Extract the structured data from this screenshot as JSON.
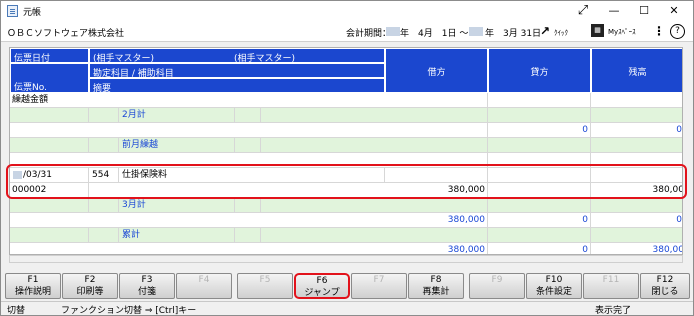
{
  "window": {
    "title": "元帳",
    "minimize": "—",
    "maximize": "☐",
    "close": "✕",
    "expand_icon": "arrows-expand-icon"
  },
  "infobar": {
    "company": "ＯＢＣソフトウェア株式会社",
    "period_label": "会計期間：",
    "period_from": "年　4月　1日 ～",
    "period_to": "年　3月 31日",
    "quick_label": "ｸｲｯｸ",
    "myspace_label": "Myｽﾍﾟｰｽ",
    "more": "⋮",
    "help": "?"
  },
  "grid": {
    "headers": {
      "date": "伝票日付",
      "partner1": "(相手マスター)",
      "partner2": "(相手マスター)",
      "account": "勘定科目 / 補助科目",
      "slip_no": "伝票No.",
      "memo": "摘要",
      "debit": "借方",
      "credit": "貸方",
      "balance": "残高"
    },
    "rows": [
      {
        "label": "繰越金額",
        "style": "white"
      },
      {
        "sub": "2月計",
        "style": "green"
      },
      {
        "debit": "",
        "credit": "0",
        "balance": "0",
        "style": "white"
      },
      {
        "sub": "前月繰越",
        "style": "green"
      },
      {
        "style": "white"
      },
      {
        "date": "/03/31",
        "code": "554",
        "account": "仕掛保険料",
        "style": "white"
      },
      {
        "slip": "000002",
        "debit": "380,000",
        "balance": "380,00",
        "style": "white"
      },
      {
        "sub": "3月計",
        "style": "green"
      },
      {
        "debit": "380,000",
        "credit": "0",
        "balance": "0",
        "style": "white"
      },
      {
        "sub": "累計",
        "style": "green"
      },
      {
        "debit": "380,000",
        "credit": "0",
        "balance": "380,00",
        "style": "white"
      }
    ]
  },
  "fkeys": [
    {
      "key": "F1",
      "label": "操作説明",
      "enabled": true
    },
    {
      "key": "F2",
      "label": "印刷等",
      "enabled": true
    },
    {
      "key": "F3",
      "label": "付箋",
      "enabled": true
    },
    {
      "key": "F4",
      "label": "",
      "enabled": false
    },
    {
      "key": "F5",
      "label": "",
      "enabled": false
    },
    {
      "key": "F6",
      "label": "ジャンプ",
      "enabled": true
    },
    {
      "key": "F7",
      "label": "",
      "enabled": false
    },
    {
      "key": "F8",
      "label": "再集計",
      "enabled": true
    },
    {
      "key": "F9",
      "label": "",
      "enabled": false
    },
    {
      "key": "F10",
      "label": "条件設定",
      "enabled": true
    },
    {
      "key": "F11",
      "label": "",
      "enabled": false
    },
    {
      "key": "F12",
      "label": "閉じる",
      "enabled": true
    }
  ],
  "status": {
    "switch": "切替",
    "hint": "ファンクション切替 ⇒ [Ctrl]キー",
    "state": "表示完了"
  },
  "colors": {
    "header_blue": "#1b47cf",
    "highlight_red": "#e2121b",
    "row_green": "#e1f4dc",
    "value_blue": "#1947d6"
  }
}
